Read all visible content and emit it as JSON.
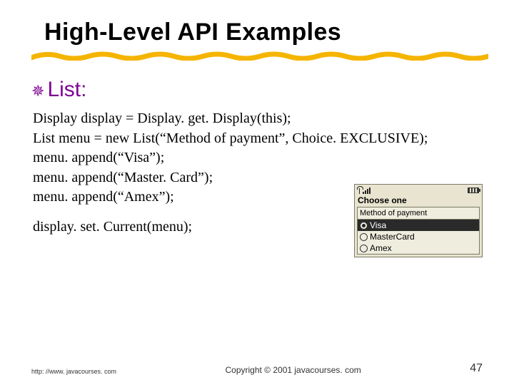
{
  "title": "High-Level API Examples",
  "subtitle": "List:",
  "code": {
    "l1": "Display display = Display. get. Display(this);",
    "l2": "List menu = new List(“Method of payment”, Choice. EXCLUSIVE);",
    "l3": "menu. append(“Visa”);",
    "l4": "menu. append(“Master. Card”);",
    "l5": "menu. append(“Amex”);",
    "l6": "display. set. Current(menu);"
  },
  "phone": {
    "window_title": "Choose one",
    "screen_title": "Method of payment",
    "options": {
      "o1": "Visa",
      "o2": "MasterCard",
      "o3": "Amex"
    }
  },
  "footer": {
    "url": "http: //www. javacourses. com",
    "copyright": "Copyright © 2001 javacourses. com",
    "page": "47"
  }
}
